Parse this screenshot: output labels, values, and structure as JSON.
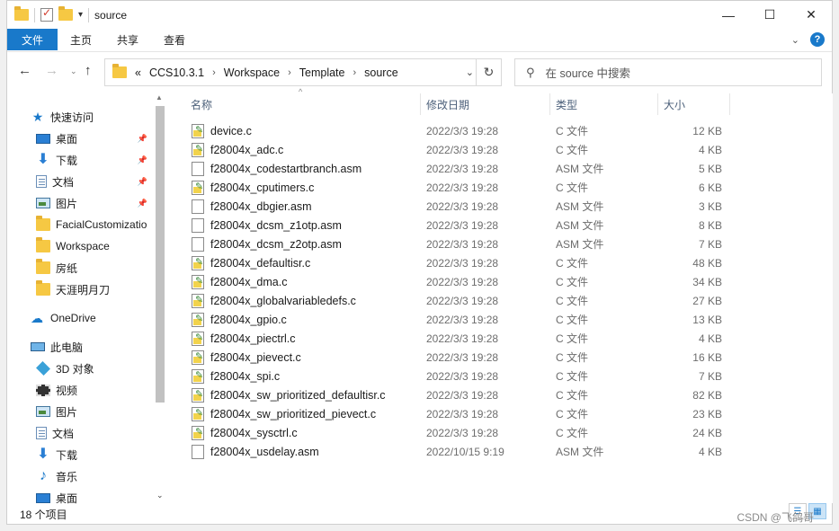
{
  "window": {
    "title": "source"
  },
  "ribbon": {
    "tabs": [
      "文件",
      "主页",
      "共享",
      "查看"
    ]
  },
  "address": {
    "overflow": "«",
    "crumbs": [
      "CCS10.3.1",
      "Workspace",
      "Template",
      "source"
    ],
    "sep": "›"
  },
  "search": {
    "placeholder": "在 source 中搜索"
  },
  "navpane": {
    "items": [
      {
        "label": "快速访问",
        "icon": "star-icon",
        "pinned": false
      },
      {
        "label": "桌面",
        "icon": "desktop-icon",
        "pinned": true
      },
      {
        "label": "下载",
        "icon": "download-icon",
        "pinned": true
      },
      {
        "label": "文档",
        "icon": "document-icon",
        "pinned": true
      },
      {
        "label": "图片",
        "icon": "pictures-icon",
        "pinned": true
      },
      {
        "label": "FacialCustomizatio",
        "icon": "folder-icon",
        "pinned": false
      },
      {
        "label": "Workspace",
        "icon": "folder-icon",
        "pinned": false
      },
      {
        "label": "房纸",
        "icon": "folder-icon",
        "pinned": false
      },
      {
        "label": "天涯明月刀",
        "icon": "folder-icon",
        "pinned": false
      },
      {
        "label": "OneDrive",
        "icon": "onedrive-icon",
        "pinned": false
      },
      {
        "label": "此电脑",
        "icon": "this-pc-icon",
        "pinned": false
      },
      {
        "label": "3D 对象",
        "icon": "3d-objects-icon",
        "pinned": false
      },
      {
        "label": "视频",
        "icon": "videos-icon",
        "pinned": false
      },
      {
        "label": "图片",
        "icon": "pictures-icon",
        "pinned": false
      },
      {
        "label": "文档",
        "icon": "document-icon",
        "pinned": false
      },
      {
        "label": "下载",
        "icon": "download-icon",
        "pinned": false
      },
      {
        "label": "音乐",
        "icon": "music-icon",
        "pinned": false
      },
      {
        "label": "桌面",
        "icon": "desktop-icon",
        "pinned": false
      }
    ]
  },
  "columns": {
    "name": "名称",
    "date": "修改日期",
    "type": "类型",
    "size": "大小"
  },
  "files": [
    {
      "name": "device.c",
      "date": "2022/3/3 19:28",
      "type": "C 文件",
      "size": "12 KB"
    },
    {
      "name": "f28004x_adc.c",
      "date": "2022/3/3 19:28",
      "type": "C 文件",
      "size": "4 KB"
    },
    {
      "name": "f28004x_codestartbranch.asm",
      "date": "2022/3/3 19:28",
      "type": "ASM 文件",
      "size": "5 KB"
    },
    {
      "name": "f28004x_cputimers.c",
      "date": "2022/3/3 19:28",
      "type": "C 文件",
      "size": "6 KB"
    },
    {
      "name": "f28004x_dbgier.asm",
      "date": "2022/3/3 19:28",
      "type": "ASM 文件",
      "size": "3 KB"
    },
    {
      "name": "f28004x_dcsm_z1otp.asm",
      "date": "2022/3/3 19:28",
      "type": "ASM 文件",
      "size": "8 KB"
    },
    {
      "name": "f28004x_dcsm_z2otp.asm",
      "date": "2022/3/3 19:28",
      "type": "ASM 文件",
      "size": "7 KB"
    },
    {
      "name": "f28004x_defaultisr.c",
      "date": "2022/3/3 19:28",
      "type": "C 文件",
      "size": "48 KB"
    },
    {
      "name": "f28004x_dma.c",
      "date": "2022/3/3 19:28",
      "type": "C 文件",
      "size": "34 KB"
    },
    {
      "name": "f28004x_globalvariabledefs.c",
      "date": "2022/3/3 19:28",
      "type": "C 文件",
      "size": "27 KB"
    },
    {
      "name": "f28004x_gpio.c",
      "date": "2022/3/3 19:28",
      "type": "C 文件",
      "size": "13 KB"
    },
    {
      "name": "f28004x_piectrl.c",
      "date": "2022/3/3 19:28",
      "type": "C 文件",
      "size": "4 KB"
    },
    {
      "name": "f28004x_pievect.c",
      "date": "2022/3/3 19:28",
      "type": "C 文件",
      "size": "16 KB"
    },
    {
      "name": "f28004x_spi.c",
      "date": "2022/3/3 19:28",
      "type": "C 文件",
      "size": "7 KB"
    },
    {
      "name": "f28004x_sw_prioritized_defaultisr.c",
      "date": "2022/3/3 19:28",
      "type": "C 文件",
      "size": "82 KB"
    },
    {
      "name": "f28004x_sw_prioritized_pievect.c",
      "date": "2022/3/3 19:28",
      "type": "C 文件",
      "size": "23 KB"
    },
    {
      "name": "f28004x_sysctrl.c",
      "date": "2022/3/3 19:28",
      "type": "C 文件",
      "size": "24 KB"
    },
    {
      "name": "f28004x_usdelay.asm",
      "date": "2022/10/15 9:19",
      "type": "ASM 文件",
      "size": "4 KB"
    }
  ],
  "status": {
    "count": "18 个项目"
  },
  "watermark": "CSDN @飞鸽哥",
  "colors": {
    "accent": "#1979ca",
    "folder": "#f6c843"
  }
}
